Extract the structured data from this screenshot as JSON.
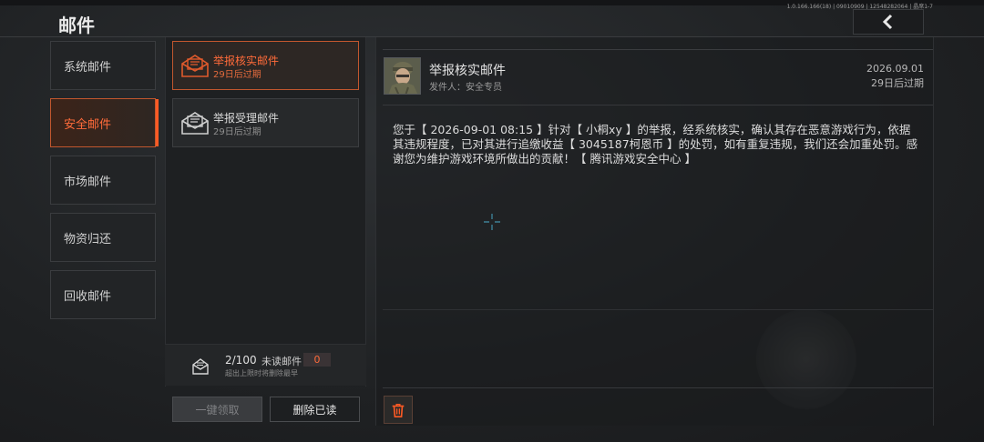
{
  "version_text": "1.0.166.166(18) | 09010909 | 12548282064 | 晶席1-7",
  "header": {
    "title": "邮件",
    "back_icon": "chevron-left-icon"
  },
  "categories": [
    {
      "label": "系统邮件",
      "active": false
    },
    {
      "label": "安全邮件",
      "active": true
    },
    {
      "label": "市场邮件",
      "active": false
    },
    {
      "label": "物资归还",
      "active": false
    },
    {
      "label": "回收邮件",
      "active": false
    }
  ],
  "mails": [
    {
      "title": "举报核实邮件",
      "expire": "29日后过期",
      "active": true,
      "icon": "open-envelope-icon"
    },
    {
      "title": "举报受理邮件",
      "expire": "29日后过期",
      "active": false,
      "icon": "open-envelope-icon"
    }
  ],
  "counter": {
    "count": "2/100",
    "unread_label": "未读邮件",
    "unread_count": "0",
    "hint": "超出上限时将删除最早"
  },
  "buttons": {
    "claim_all": "一键领取",
    "delete_read": "删除已读"
  },
  "reader": {
    "title": "举报核实邮件",
    "sender": "发件人：安全专员",
    "date": "2026.09.01",
    "expire": "29日后过期",
    "body": "您于【 2026-09-01 08:15 】针对【 小桐xy 】的举报，经系统核实，确认其存在恶意游戏行为，依据其违规程度，已对其进行追缴收益【 3045187柯恩币 】的处罚，如有重复违规，我们还会加重处罚。感谢您为维护游戏环境所做出的贡献！【 腾讯游戏安全中心 】"
  },
  "colors": {
    "accent": "#ff6b3a",
    "accent_border": "#c2572e",
    "panel": "#222426"
  }
}
